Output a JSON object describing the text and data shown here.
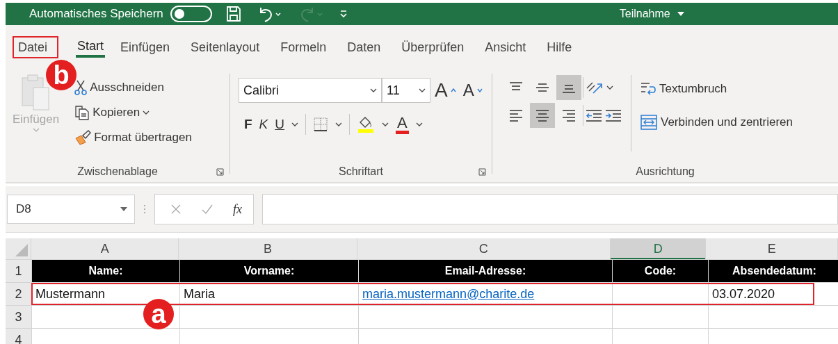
{
  "title_bar": {
    "autosave_label": "Automatisches Speichern",
    "autosave_on": false,
    "document_title": "Teilnahme"
  },
  "tabs": [
    {
      "label": "Datei",
      "selected": false
    },
    {
      "label": "Start",
      "selected": true
    },
    {
      "label": "Einfügen",
      "selected": false
    },
    {
      "label": "Seitenlayout",
      "selected": false
    },
    {
      "label": "Formeln",
      "selected": false
    },
    {
      "label": "Daten",
      "selected": false
    },
    {
      "label": "Überprüfen",
      "selected": false
    },
    {
      "label": "Ansicht",
      "selected": false
    },
    {
      "label": "Hilfe",
      "selected": false
    }
  ],
  "clipboard": {
    "title": "Zwischenablage",
    "paste": {
      "label": "Einfügen",
      "disabled": true
    },
    "items": [
      {
        "kind": "cut",
        "label": "Ausschneiden",
        "dropdown": false
      },
      {
        "kind": "copy",
        "label": "Kopieren",
        "dropdown": true
      },
      {
        "kind": "format",
        "label": "Format übertragen",
        "dropdown": false
      }
    ]
  },
  "font": {
    "title": "Schriftart",
    "font_name": "Calibri",
    "font_size": "11",
    "grow": "A",
    "shrink": "A",
    "bold": "F",
    "italic": "K",
    "underline": "U",
    "font_color": "A"
  },
  "alignment": {
    "title": "Ausrichtung",
    "vertical": [
      {
        "kind": "top",
        "selected": false
      },
      {
        "kind": "middle",
        "selected": false
      },
      {
        "kind": "bottom",
        "selected": true
      }
    ],
    "horizontal": [
      {
        "kind": "left",
        "selected": false
      },
      {
        "kind": "center",
        "selected": true
      },
      {
        "kind": "right",
        "selected": false
      }
    ],
    "wrap": "Textumbruch",
    "merge": "Verbinden und zentrieren"
  },
  "formula_bar": {
    "name_box": "D8",
    "fx": "fx"
  },
  "sheet": {
    "columns": [
      {
        "label": "A",
        "selected": false
      },
      {
        "label": "B",
        "selected": false
      },
      {
        "label": "C",
        "selected": false
      },
      {
        "label": "D",
        "selected": true
      },
      {
        "label": "E",
        "selected": false
      }
    ],
    "rows": [
      {
        "number": "1",
        "kind": "header",
        "cells": [
          {
            "text": "Name:"
          },
          {
            "text": "Vorname:"
          },
          {
            "text": "Email-Adresse:"
          },
          {
            "text": "Code:"
          },
          {
            "text": "Absendedatum:"
          }
        ]
      },
      {
        "number": "2",
        "kind": "data",
        "cells": [
          {
            "text": "Mustermann",
            "kind": "text"
          },
          {
            "text": "Maria",
            "kind": "text"
          },
          {
            "text": "maria.mustermann@charite.de",
            "kind": "link"
          },
          {
            "kind": "empty"
          },
          {
            "text": "03.07.2020",
            "kind": "text"
          }
        ]
      },
      {
        "number": "3",
        "kind": "empty"
      },
      {
        "number": "4",
        "kind": "empty"
      }
    ]
  },
  "annotations": [
    {
      "label": "b"
    },
    {
      "label": "a"
    }
  ]
}
